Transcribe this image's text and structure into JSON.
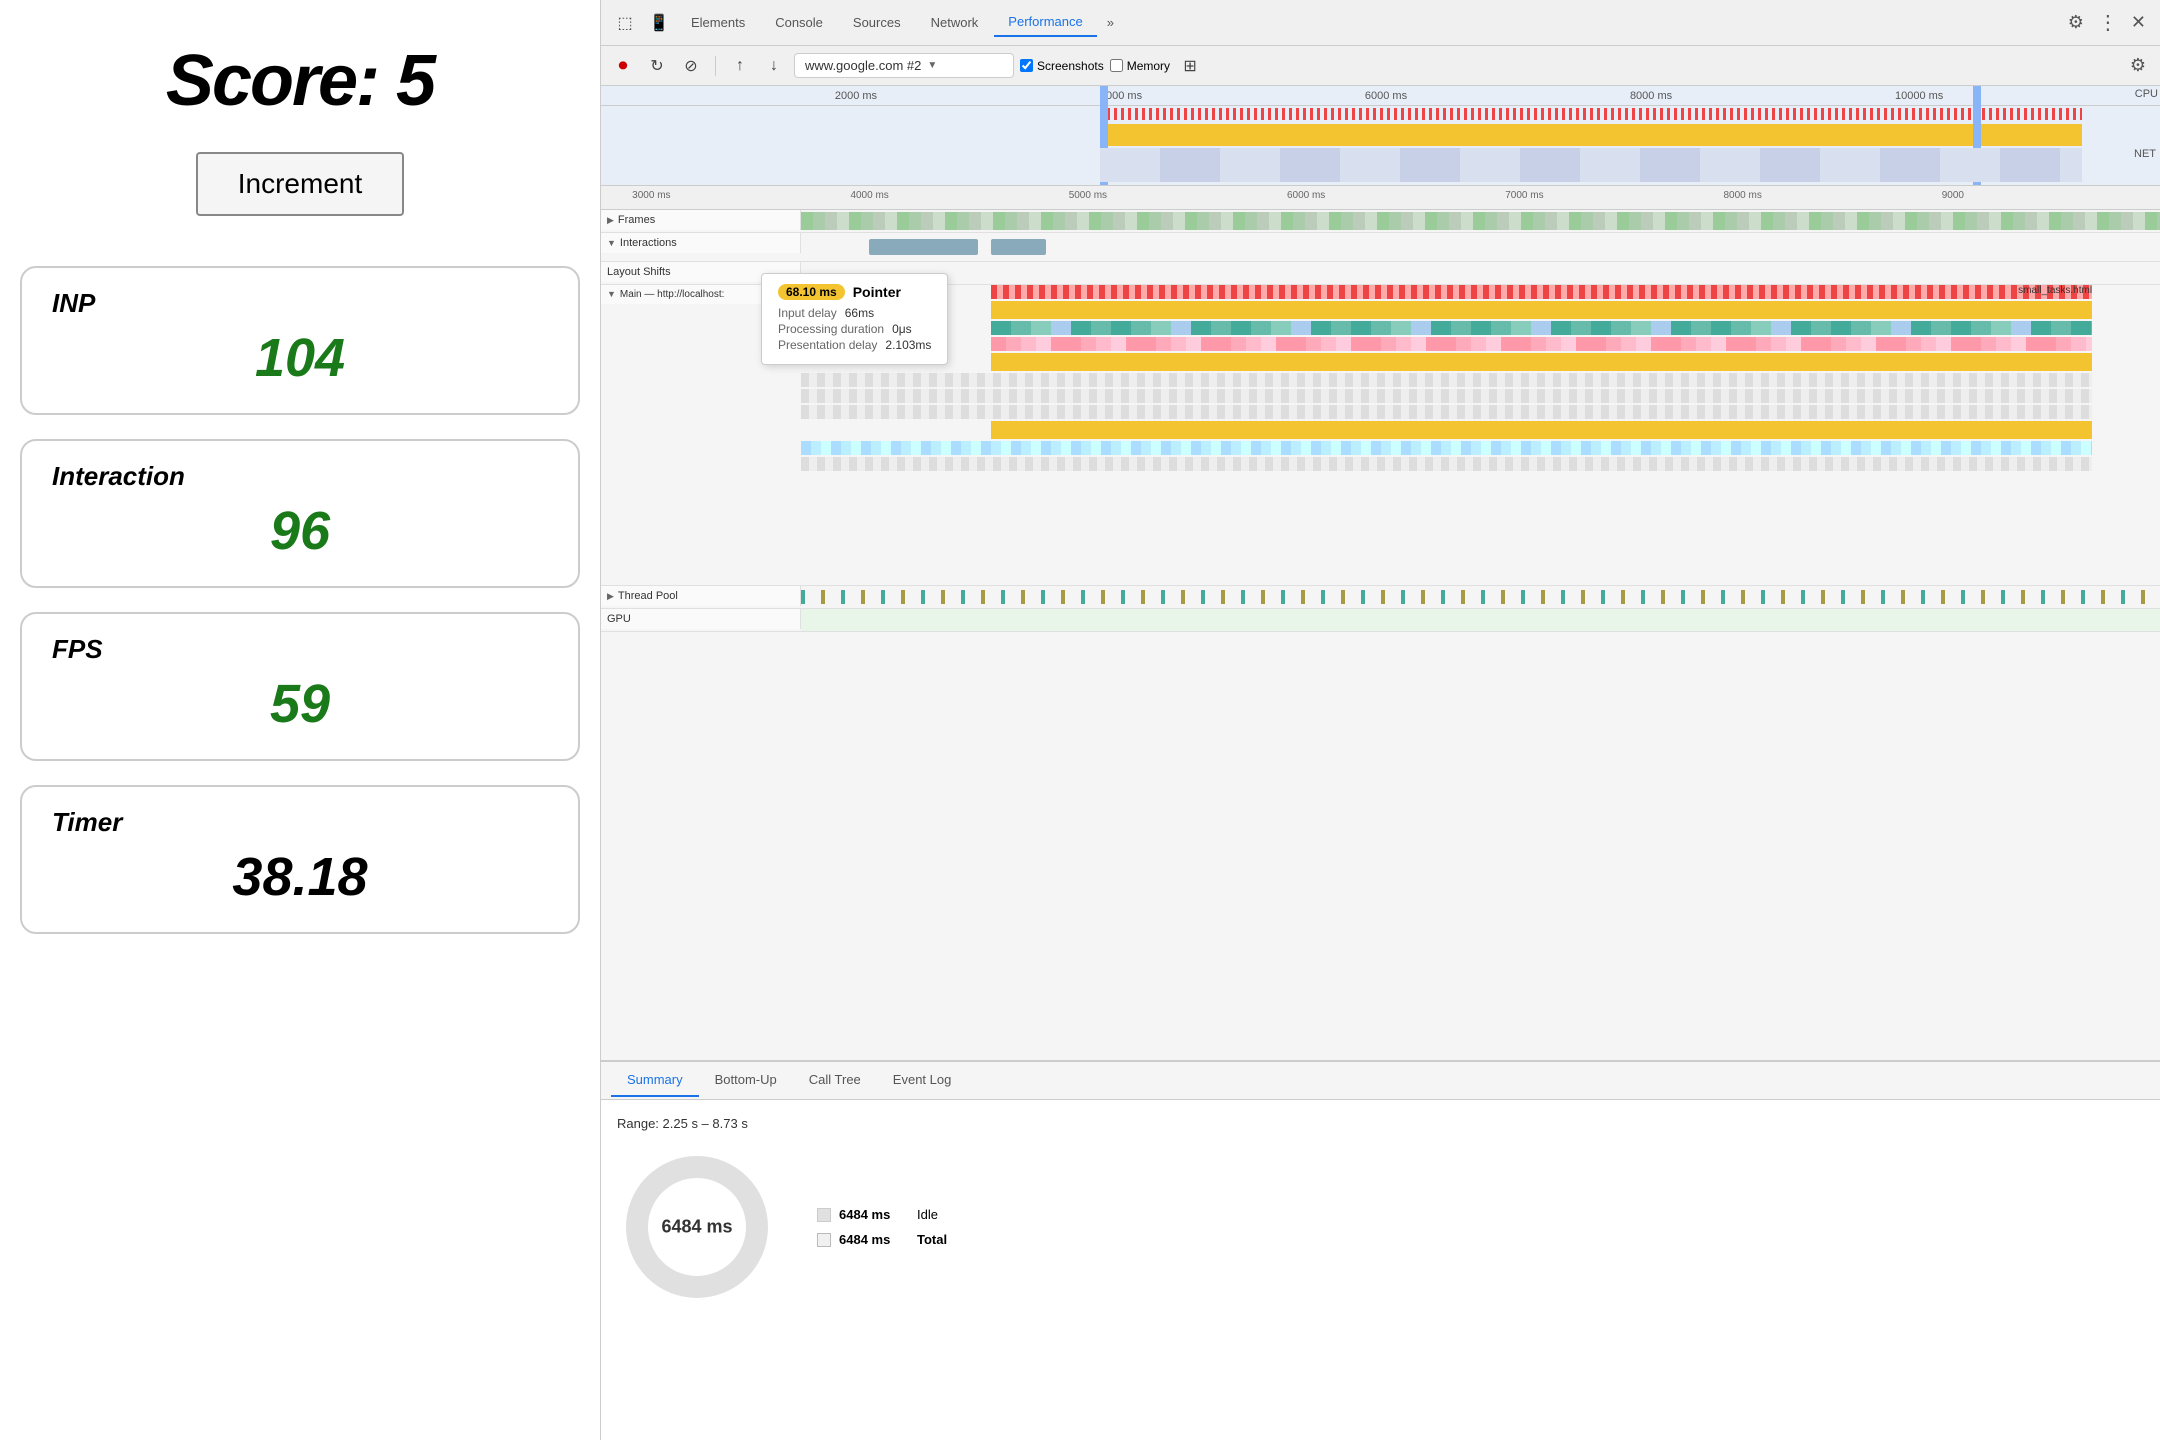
{
  "left": {
    "score_label": "Score:",
    "score_value": "5",
    "increment_btn": "Increment",
    "metrics": [
      {
        "id": "inp",
        "label": "INP",
        "value": "104",
        "timer": false
      },
      {
        "id": "interaction",
        "label": "Interaction",
        "value": "96",
        "timer": false
      },
      {
        "id": "fps",
        "label": "FPS",
        "value": "59",
        "timer": false
      },
      {
        "id": "timer",
        "label": "Timer",
        "value": "38.18",
        "timer": true
      }
    ]
  },
  "devtools": {
    "tabs": [
      "Elements",
      "Console",
      "Sources",
      "Network",
      "Performance",
      "»"
    ],
    "active_tab": "Performance",
    "toolbar": {
      "url": "www.google.com #2",
      "screenshots_label": "Screenshots",
      "memory_label": "Memory"
    },
    "timeline": {
      "overview_marks": [
        "2000 ms",
        "4000 ms",
        "6000 ms",
        "8000 ms",
        "10000 ms"
      ],
      "detail_marks": [
        "3000 ms",
        "4000 ms",
        "5000 ms",
        "6000 ms",
        "7000 ms",
        "8000 ms",
        "9000"
      ],
      "tracks": [
        {
          "id": "frames",
          "label": "Frames",
          "arrow": "▶"
        },
        {
          "id": "interactions",
          "label": "Interactions",
          "arrow": "▼"
        },
        {
          "id": "layout-shifts",
          "label": "Layout Shifts"
        },
        {
          "id": "main",
          "label": "Main — http://localhost:",
          "arrow": "▼",
          "suffix": "small_tasks.html"
        },
        {
          "id": "thread-pool",
          "label": "Thread Pool",
          "arrow": "▶"
        },
        {
          "id": "gpu",
          "label": "GPU"
        }
      ]
    },
    "tooltip": {
      "time": "68.10 ms",
      "type": "Pointer",
      "input_delay_label": "Input delay",
      "input_delay_val": "66ms",
      "processing_label": "Processing duration",
      "processing_val": "0μs",
      "presentation_label": "Presentation delay",
      "presentation_val": "2.103ms"
    },
    "bottom": {
      "tabs": [
        "Summary",
        "Bottom-Up",
        "Call Tree",
        "Event Log"
      ],
      "active_tab": "Summary",
      "range_text": "Range: 2.25 s – 8.73 s",
      "donut_label": "6484 ms",
      "legend": [
        {
          "label": "Idle",
          "ms": "6484 ms"
        },
        {
          "label": "Total",
          "ms": "6484 ms",
          "bold": true
        }
      ]
    }
  }
}
